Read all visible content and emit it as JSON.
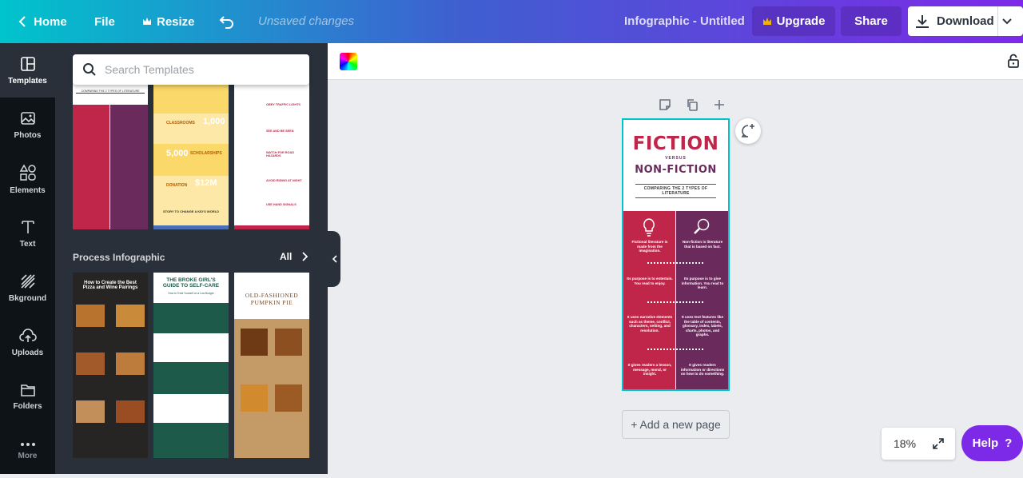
{
  "topbar": {
    "home": "Home",
    "file": "File",
    "resize": "Resize",
    "unsaved": "Unsaved changes",
    "title": "Infographic - Untitled",
    "upgrade": "Upgrade",
    "share": "Share",
    "download": "Download"
  },
  "rail": [
    {
      "label": "Templates",
      "icon": "templates-icon"
    },
    {
      "label": "Photos",
      "icon": "photos-icon"
    },
    {
      "label": "Elements",
      "icon": "elements-icon"
    },
    {
      "label": "Text",
      "icon": "text-icon"
    },
    {
      "label": "Bkground",
      "icon": "background-icon"
    },
    {
      "label": "Uploads",
      "icon": "uploads-icon"
    },
    {
      "label": "Folders",
      "icon": "folders-icon"
    },
    {
      "label": "More",
      "icon": "more-icon"
    }
  ],
  "panel": {
    "search_placeholder": "Search Templates",
    "section_title": "Process Infographic",
    "section_all": "All",
    "top_templates": {
      "t1": {
        "subtitle": "COMPARING THE 2 TYPES OF LITERATURE"
      },
      "t2": {
        "label1": "CLASSROOMS",
        "value1": "1,000",
        "label2": "SCHOLARSHIPS",
        "value2": "5,000",
        "label3": "DONATION",
        "value3": "$12M",
        "footer": "STORY TO CHANGE A KID'S WORLD"
      },
      "t3": {
        "items": [
          "OBEY TRAFFIC LIGHTS",
          "SEE AND BE SEEN",
          "WATCH FOR ROAD HAZARDS",
          "AVOID RIDING AT NIGHT",
          "USE HAND SIGNALS"
        ]
      }
    },
    "process_templates": {
      "p1": {
        "title": "How to Create the Best Pizza and Wine Pairings"
      },
      "p2": {
        "title": "THE BROKE GIRL'S GUIDE TO SELF-CARE",
        "subtitle": "How to Treat Yourself on a Low Budget"
      },
      "p3": {
        "title": "OLD-FASHIONED PUMPKIN PIE"
      }
    }
  },
  "workspace": {
    "add_page": "+ Add a new page",
    "zoom": "18%",
    "help": "Help",
    "help_mark": "?"
  },
  "page": {
    "title1": "FICTION",
    "versus": "VERSUS",
    "title2": "NON-FICTION",
    "subtitle": "COMPARING THE 2 TYPES OF LITERATURE",
    "left": [
      "Fictional literature is made from the imagination.",
      "Its purpose is to entertain. You read to enjoy.",
      "It uses narrative elements such as theme, conflict, characters, setting, and resolution.",
      "It gives readers a lesson, message, moral, or insight."
    ],
    "right": [
      "Non-fiction is literature that is based on fact.",
      "Its purpose is to give information. You read to learn.",
      "It uses text features like the table of contents, glossary, index, labels, charts, photos, and graphs.",
      "It gives readers information or directions on how to do something."
    ]
  },
  "colors": {
    "brand_gradient_start": "#00c4cc",
    "brand_gradient_end": "#7d2ae8",
    "fiction_red": "#c0264a",
    "nonfiction_purple": "#6b2a5c",
    "selection": "#00c4cc"
  }
}
